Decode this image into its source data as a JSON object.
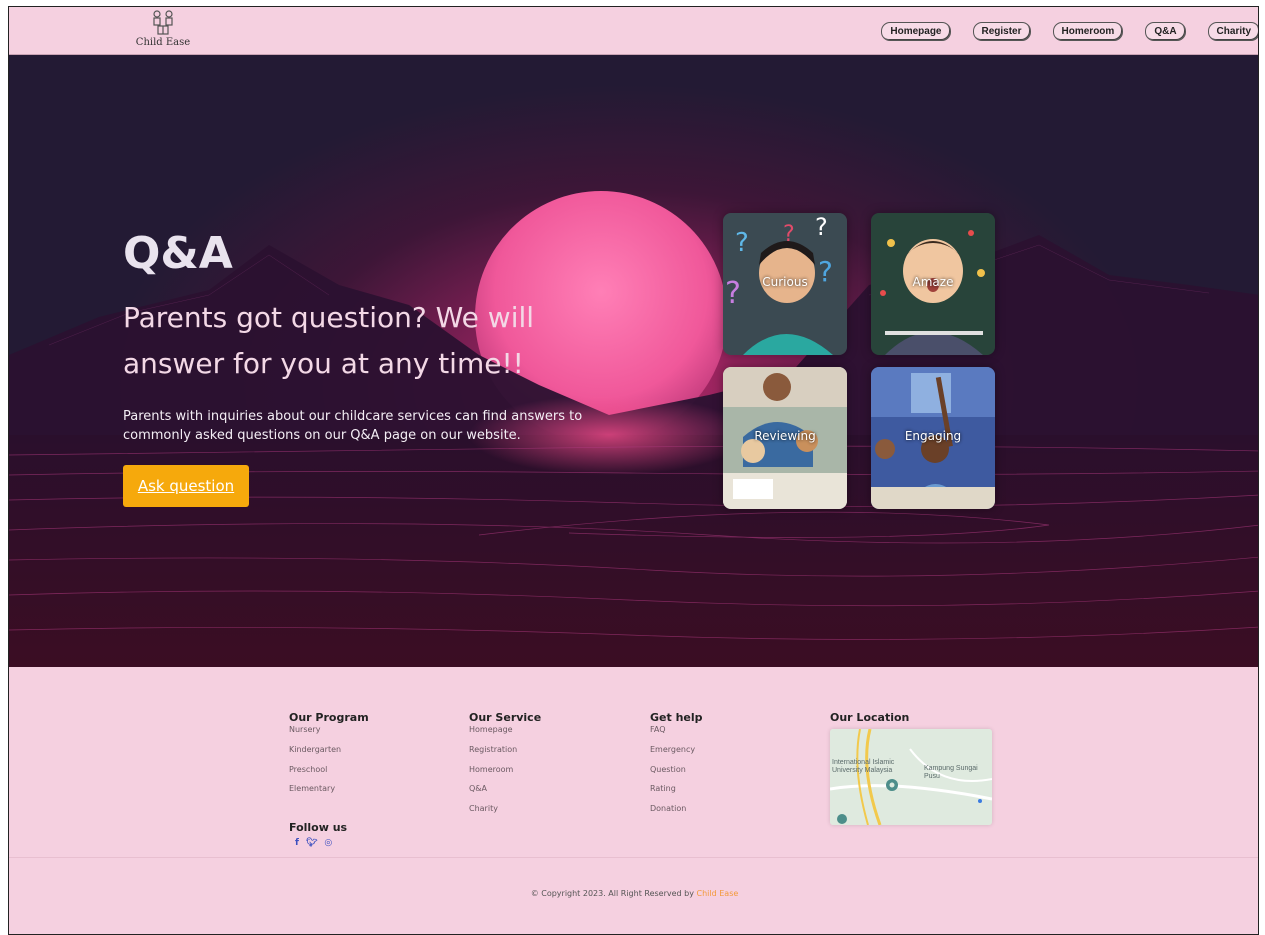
{
  "header": {
    "logo_text": "Child Ease",
    "nav": [
      "Homepage",
      "Register",
      "Homeroom",
      "Q&A",
      "Charity"
    ]
  },
  "hero": {
    "title": "Q&A",
    "subtitle": "Parents got question? We will answer for you at any time!!",
    "description": "Parents with inquiries about our childcare services can find answers to commonly asked questions on our Q&A page on our website.",
    "cta_label": "Ask question",
    "cards": [
      "Curious",
      "Amaze",
      "Reviewing",
      "Engaging"
    ]
  },
  "footer": {
    "program": {
      "title": "Our Program",
      "items": [
        "Nursery",
        "Kindergarten",
        "Preschool",
        "Elementary"
      ]
    },
    "service": {
      "title": "Our Service",
      "items": [
        "Homepage",
        "Registration",
        "Homeroom",
        "Q&A",
        "Charity"
      ]
    },
    "help": {
      "title": "Get help",
      "items": [
        "FAQ",
        "Emergency",
        "Question",
        "Rating",
        "Donation"
      ]
    },
    "location": {
      "title": "Our Location",
      "map_labels": [
        "International Islamic University Malaysia",
        "Kampung Sungai Pusu"
      ]
    },
    "follow": {
      "title": "Follow us",
      "icons": [
        "facebook-icon",
        "twitter-icon",
        "instagram-icon"
      ]
    },
    "copyright_prefix": "© Copyright 2023. All Right Reserved by",
    "copyright_brand": "Child Ease"
  },
  "colors": {
    "header_bg": "#f5d0e0",
    "cta": "#f6a90c",
    "brand_accent": "#f39a3a"
  }
}
